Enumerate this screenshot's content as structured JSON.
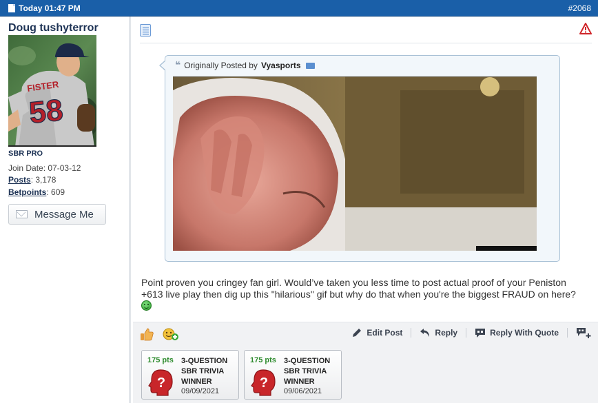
{
  "header": {
    "date_label": "Today 01:47 PM",
    "post_number": "#2068"
  },
  "user": {
    "username": "Doug tushyterror",
    "rank": "SBR PRO",
    "join_date_label": "Join Date:",
    "join_date": "07-03-12",
    "posts_label": "Posts",
    "posts": "3,178",
    "betpoints_label": "Betpoints",
    "betpoints": "609",
    "message_button": "Message Me",
    "jersey_name": "FISTER",
    "jersey_number": "58"
  },
  "quote": {
    "prefix": "Originally Posted by",
    "author": "Vyasports"
  },
  "post": {
    "text": "Point proven you cringey fan girl. Would’ve taken you less time to post actual proof of your Peniston +613 live play then dig up this \"hilarious\" gif but why do that when you're the biggest FRAUD on here?"
  },
  "actions": {
    "edit": "Edit Post",
    "reply": "Reply",
    "reply_quote": "Reply With Quote"
  },
  "awards": [
    {
      "pts": "175 pts",
      "title": "3-QUESTION SBR TRIVIA WINNER",
      "date": "09/09/2021"
    },
    {
      "pts": "175 pts",
      "title": "3-QUESTION SBR TRIVIA WINNER",
      "date": "09/06/2021"
    }
  ],
  "colors": {
    "header_bar": "#1a5fa8",
    "username": "#1e3355",
    "points_green": "#2e8b2e",
    "award_red": "#c8262a"
  },
  "icons": [
    "document-icon",
    "note-icon",
    "warning-icon",
    "quote-icon",
    "envelope-icon",
    "thumbs-up-icon",
    "add-reaction-icon",
    "pencil-icon",
    "reply-icon",
    "reply-with-quote-icon",
    "multi-quote-icon",
    "smiley-icon",
    "question-head-icon"
  ]
}
